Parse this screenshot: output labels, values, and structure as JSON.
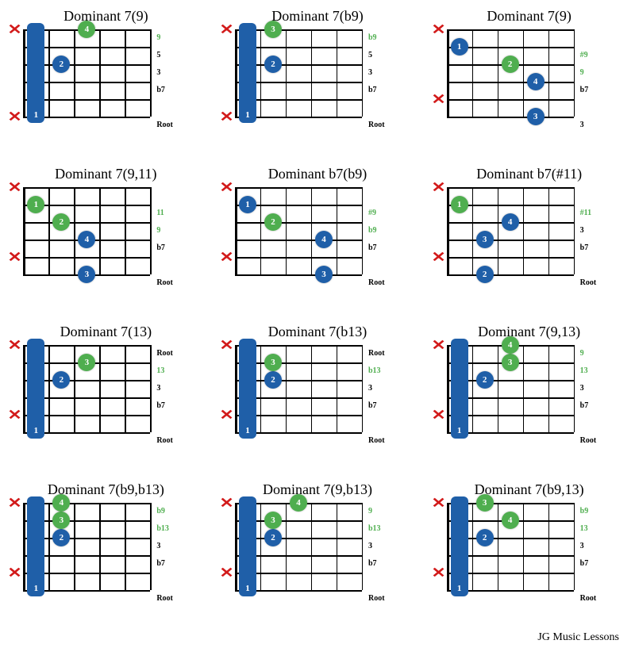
{
  "layout": {
    "frets": 5,
    "strings": 6,
    "board_w": 160,
    "board_h": 110
  },
  "colors": {
    "blue": "#1f5fa8",
    "green": "#4fae4f",
    "mute": "#d21a1a"
  },
  "footer": "JG Music Lessons",
  "chords": [
    {
      "title": "Dominant 7(9)",
      "mutes": [
        1,
        6
      ],
      "barre": {
        "fret": 1,
        "from": 1,
        "to": 6,
        "label": "1"
      },
      "dots": [
        {
          "fret": 2,
          "string": 4,
          "color": "blue",
          "label": "2"
        },
        {
          "fret": 3,
          "string": 6,
          "color": "green",
          "label": "4"
        }
      ],
      "intervals": [
        {
          "s": 6,
          "t": "9",
          "c": "g"
        },
        {
          "s": 5,
          "t": "5",
          "c": "b"
        },
        {
          "s": 4,
          "t": "3",
          "c": "b"
        },
        {
          "s": 3,
          "t": "b7",
          "c": "b"
        },
        {
          "s": 1,
          "t": "Root",
          "c": "b"
        }
      ]
    },
    {
      "title": "Dominant 7(b9)",
      "mutes": [
        1,
        6
      ],
      "barre": {
        "fret": 1,
        "from": 1,
        "to": 6,
        "label": "1"
      },
      "dots": [
        {
          "fret": 2,
          "string": 4,
          "color": "blue",
          "label": "2"
        },
        {
          "fret": 2,
          "string": 6,
          "color": "green",
          "label": "3"
        }
      ],
      "intervals": [
        {
          "s": 6,
          "t": "b9",
          "c": "g"
        },
        {
          "s": 5,
          "t": "5",
          "c": "b"
        },
        {
          "s": 4,
          "t": "3",
          "c": "b"
        },
        {
          "s": 3,
          "t": "b7",
          "c": "b"
        },
        {
          "s": 1,
          "t": "Root",
          "c": "b"
        }
      ]
    },
    {
      "title": "Dominant 7(9)",
      "mutes": [
        6,
        2
      ],
      "dots": [
        {
          "fret": 1,
          "string": 5,
          "color": "blue",
          "label": "1"
        },
        {
          "fret": 3,
          "string": 4,
          "color": "green",
          "label": "2"
        },
        {
          "fret": 4,
          "string": 3,
          "color": "blue",
          "label": "4"
        },
        {
          "fret": 4,
          "string": 1,
          "color": "blue",
          "label": "3"
        }
      ],
      "intervals": [
        {
          "s": 5,
          "t": "#9",
          "c": "g"
        },
        {
          "s": 4,
          "t": "9",
          "c": "g"
        },
        {
          "s": 3,
          "t": "b7",
          "c": "b"
        },
        {
          "s": 1,
          "t": "3",
          "c": "b"
        }
      ]
    },
    {
      "title": "Dominant 7(9,11)",
      "mutes": [
        6,
        2
      ],
      "dots": [
        {
          "fret": 1,
          "string": 5,
          "color": "green",
          "label": "1"
        },
        {
          "fret": 2,
          "string": 4,
          "color": "green",
          "label": "2"
        },
        {
          "fret": 3,
          "string": 3,
          "color": "blue",
          "label": "4"
        },
        {
          "fret": 3,
          "string": 1,
          "color": "blue",
          "label": "3"
        }
      ],
      "intervals": [
        {
          "s": 5,
          "t": "11",
          "c": "g"
        },
        {
          "s": 4,
          "t": "9",
          "c": "g"
        },
        {
          "s": 3,
          "t": "b7",
          "c": "b"
        },
        {
          "s": 1,
          "t": "Root",
          "c": "b"
        }
      ]
    },
    {
      "title": "Dominant b7(b9)",
      "mutes": [
        6,
        2
      ],
      "dots": [
        {
          "fret": 1,
          "string": 5,
          "color": "blue",
          "label": "1"
        },
        {
          "fret": 2,
          "string": 4,
          "color": "green",
          "label": "2"
        },
        {
          "fret": 4,
          "string": 3,
          "color": "blue",
          "label": "4"
        },
        {
          "fret": 4,
          "string": 1,
          "color": "blue",
          "label": "3"
        }
      ],
      "intervals": [
        {
          "s": 5,
          "t": "#9",
          "c": "g"
        },
        {
          "s": 4,
          "t": "b9",
          "c": "g"
        },
        {
          "s": 3,
          "t": "b7",
          "c": "b"
        },
        {
          "s": 1,
          "t": "Root",
          "c": "b"
        }
      ]
    },
    {
      "title": "Dominant b7(#11)",
      "mutes": [
        6,
        2
      ],
      "dots": [
        {
          "fret": 1,
          "string": 5,
          "color": "green",
          "label": "1"
        },
        {
          "fret": 2,
          "string": 3,
          "color": "blue",
          "label": "3"
        },
        {
          "fret": 2,
          "string": 1,
          "color": "blue",
          "label": "2"
        },
        {
          "fret": 3,
          "string": 4,
          "color": "blue",
          "label": "4"
        }
      ],
      "intervals": [
        {
          "s": 5,
          "t": "#11",
          "c": "g"
        },
        {
          "s": 4,
          "t": "3",
          "c": "b"
        },
        {
          "s": 3,
          "t": "b7",
          "c": "b"
        },
        {
          "s": 1,
          "t": "Root",
          "c": "b"
        }
      ]
    },
    {
      "title": "Dominant 7(13)",
      "mutes": [
        6,
        2
      ],
      "barre": {
        "fret": 1,
        "from": 1,
        "to": 6,
        "label": "1"
      },
      "dots": [
        {
          "fret": 2,
          "string": 4,
          "color": "blue",
          "label": "2"
        },
        {
          "fret": 3,
          "string": 5,
          "color": "green",
          "label": "3"
        }
      ],
      "intervals": [
        {
          "s": 6,
          "t": "Root",
          "c": "b"
        },
        {
          "s": 5,
          "t": "13",
          "c": "g"
        },
        {
          "s": 4,
          "t": "3",
          "c": "b"
        },
        {
          "s": 3,
          "t": "b7",
          "c": "b"
        },
        {
          "s": 1,
          "t": "Root",
          "c": "b"
        }
      ]
    },
    {
      "title": "Dominant 7(b13)",
      "mutes": [
        6,
        2
      ],
      "barre": {
        "fret": 1,
        "from": 1,
        "to": 6,
        "label": "1"
      },
      "dots": [
        {
          "fret": 2,
          "string": 4,
          "color": "blue",
          "label": "2"
        },
        {
          "fret": 2,
          "string": 5,
          "color": "green",
          "label": "3"
        }
      ],
      "intervals": [
        {
          "s": 6,
          "t": "Root",
          "c": "b"
        },
        {
          "s": 5,
          "t": "b13",
          "c": "g"
        },
        {
          "s": 4,
          "t": "3",
          "c": "b"
        },
        {
          "s": 3,
          "t": "b7",
          "c": "b"
        },
        {
          "s": 1,
          "t": "Root",
          "c": "b"
        }
      ]
    },
    {
      "title": "Dominant 7(9,13)",
      "mutes": [
        6,
        2
      ],
      "barre": {
        "fret": 1,
        "from": 1,
        "to": 6,
        "label": "1"
      },
      "dots": [
        {
          "fret": 2,
          "string": 4,
          "color": "blue",
          "label": "2"
        },
        {
          "fret": 3,
          "string": 5,
          "color": "green",
          "label": "3"
        },
        {
          "fret": 3,
          "string": 6,
          "color": "green",
          "label": "4"
        }
      ],
      "intervals": [
        {
          "s": 6,
          "t": "9",
          "c": "g"
        },
        {
          "s": 5,
          "t": "13",
          "c": "g"
        },
        {
          "s": 4,
          "t": "3",
          "c": "b"
        },
        {
          "s": 3,
          "t": "b7",
          "c": "b"
        },
        {
          "s": 1,
          "t": "Root",
          "c": "b"
        }
      ]
    },
    {
      "title": "Dominant 7(b9,b13)",
      "mutes": [
        6,
        2
      ],
      "barre": {
        "fret": 1,
        "from": 1,
        "to": 6,
        "label": "1"
      },
      "dots": [
        {
          "fret": 2,
          "string": 4,
          "color": "blue",
          "label": "2"
        },
        {
          "fret": 2,
          "string": 5,
          "color": "green",
          "label": "3"
        },
        {
          "fret": 2,
          "string": 6,
          "color": "green",
          "label": "4"
        }
      ],
      "intervals": [
        {
          "s": 6,
          "t": "b9",
          "c": "g"
        },
        {
          "s": 5,
          "t": "b13",
          "c": "g"
        },
        {
          "s": 4,
          "t": "3",
          "c": "b"
        },
        {
          "s": 3,
          "t": "b7",
          "c": "b"
        },
        {
          "s": 1,
          "t": "Root",
          "c": "b"
        }
      ]
    },
    {
      "title": "Dominant 7(9,b13)",
      "mutes": [
        6,
        2
      ],
      "barre": {
        "fret": 1,
        "from": 1,
        "to": 6,
        "label": "1"
      },
      "dots": [
        {
          "fret": 2,
          "string": 4,
          "color": "blue",
          "label": "2"
        },
        {
          "fret": 2,
          "string": 5,
          "color": "green",
          "label": "3"
        },
        {
          "fret": 3,
          "string": 6,
          "color": "green",
          "label": "4"
        }
      ],
      "intervals": [
        {
          "s": 6,
          "t": "9",
          "c": "g"
        },
        {
          "s": 5,
          "t": "b13",
          "c": "g"
        },
        {
          "s": 4,
          "t": "3",
          "c": "b"
        },
        {
          "s": 3,
          "t": "b7",
          "c": "b"
        },
        {
          "s": 1,
          "t": "Root",
          "c": "b"
        }
      ]
    },
    {
      "title": "Dominant 7(b9,13)",
      "mutes": [
        6,
        2
      ],
      "barre": {
        "fret": 1,
        "from": 1,
        "to": 6,
        "label": "1"
      },
      "dots": [
        {
          "fret": 2,
          "string": 4,
          "color": "blue",
          "label": "2"
        },
        {
          "fret": 2,
          "string": 6,
          "color": "green",
          "label": "3"
        },
        {
          "fret": 3,
          "string": 5,
          "color": "green",
          "label": "4"
        }
      ],
      "intervals": [
        {
          "s": 6,
          "t": "b9",
          "c": "g"
        },
        {
          "s": 5,
          "t": "13",
          "c": "g"
        },
        {
          "s": 4,
          "t": "3",
          "c": "b"
        },
        {
          "s": 3,
          "t": "b7",
          "c": "b"
        },
        {
          "s": 1,
          "t": "Root",
          "c": "b"
        }
      ]
    }
  ]
}
